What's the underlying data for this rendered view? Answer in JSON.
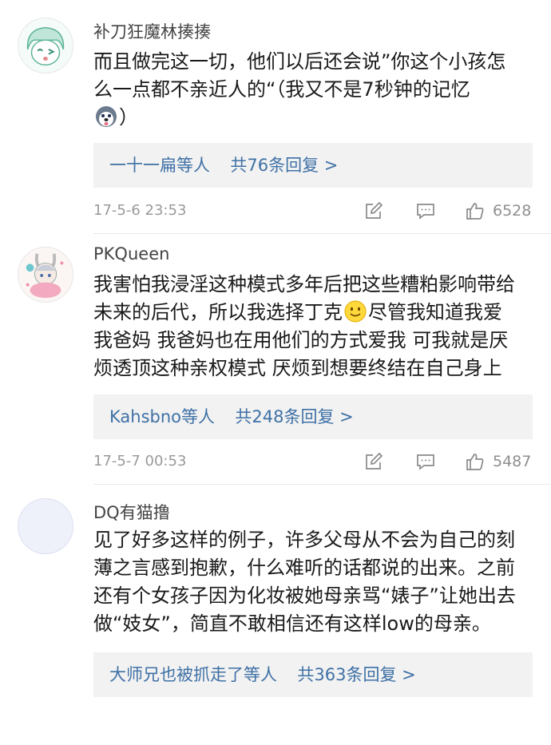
{
  "comments": [
    {
      "username": "补刀狂魔林揍揍",
      "lines": [
        "而且做完这一切，他们以后还会说”你这个小孩怎",
        "么一点都不亲近人的“（我又不是7秒钟的记忆",
        "）"
      ],
      "emoji_icon": "husky-dog-icon",
      "reply_users": "一十一扁等人",
      "reply_count": "共76条回复 >",
      "date": "17-5-6 23:53",
      "likes": "6528"
    },
    {
      "username": "PKQueen",
      "lines": [
        "我害怕我浸淫这种模式多年后把这些糟粕影响带给",
        "未来的后代，所以我选择丁克",
        "尽管我知道我爱",
        "我爸妈 我爸妈也在用他们的方式爱我 可我就是厌",
        "烦透顶这种亲权模式 厌烦到想要终结在自己身上"
      ],
      "emoji_icon": "smile-emoji-icon",
      "reply_users": "Kahsbno等人",
      "reply_count": "共248条回复 >",
      "date": "17-5-7 00:53",
      "likes": "5487"
    },
    {
      "username": "DQ有猫撸",
      "lines": [
        "见了好多这样的例子，许多父母从不会为自己的刻",
        "薄之言感到抱歉，什么难听的话都说的出来。之前",
        "还有个女孩子因为化妆被她母亲骂“婊子”让她出去",
        "做“妓女”，简直不敢相信还有这样low的母亲。"
      ],
      "reply_users": "大师兄也被抓走了等人",
      "reply_count": "共363条回复 >"
    }
  ],
  "icons": {
    "repost": "repost-icon",
    "comment": "comment-icon",
    "like": "thumbs-up-icon"
  },
  "colors": {
    "link": "#3f71a6",
    "reply_bg": "#f2f2f2",
    "meta": "#9a9a9a"
  }
}
